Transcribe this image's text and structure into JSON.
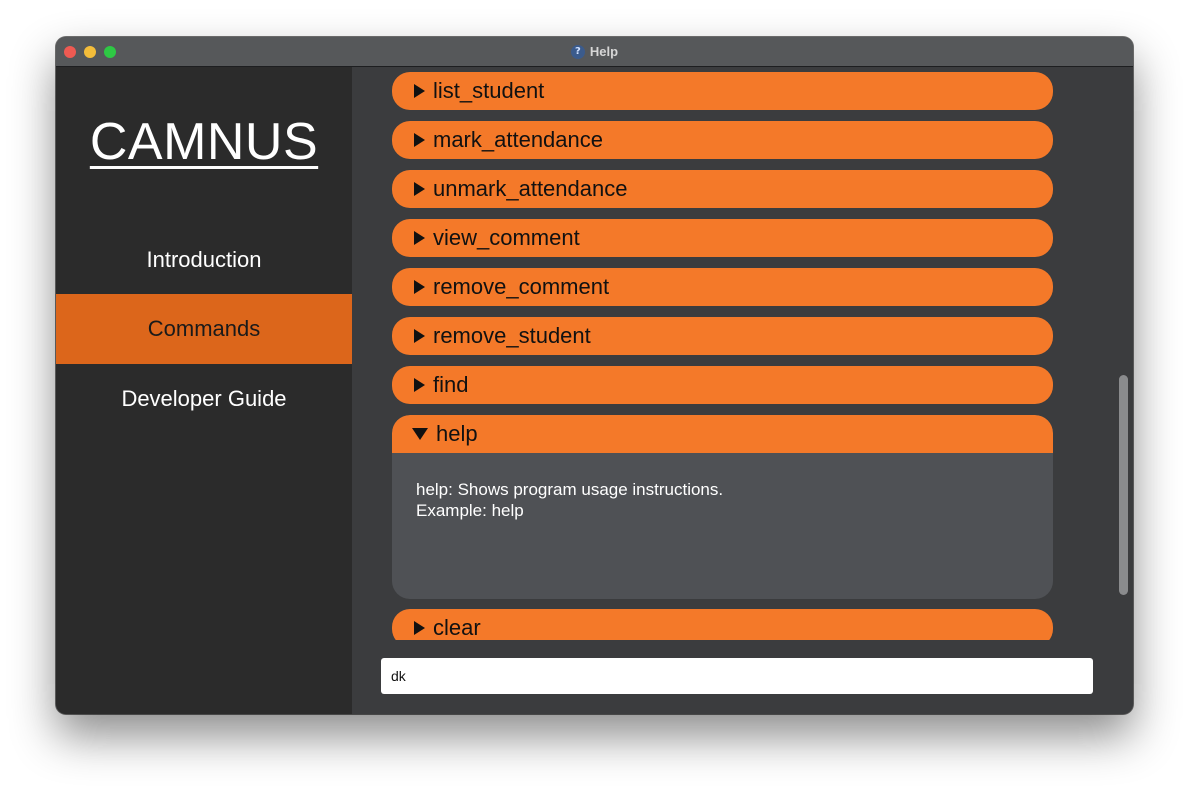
{
  "window": {
    "title": "Help",
    "title_icon": "question-mark-icon"
  },
  "sidebar": {
    "logo": "CAMNUS",
    "items": [
      {
        "label": "Introduction",
        "active": false
      },
      {
        "label": "Commands",
        "active": true
      },
      {
        "label": "Developer Guide",
        "active": false
      }
    ]
  },
  "commands": {
    "items": [
      {
        "label": "list_student",
        "expanded": false
      },
      {
        "label": "mark_attendance",
        "expanded": false
      },
      {
        "label": "unmark_attendance",
        "expanded": false
      },
      {
        "label": "view_comment",
        "expanded": false
      },
      {
        "label": "remove_comment",
        "expanded": false
      },
      {
        "label": "remove_student",
        "expanded": false
      },
      {
        "label": "find",
        "expanded": false
      },
      {
        "label": "help",
        "expanded": true,
        "description_line1": "help: Shows program usage instructions.",
        "description_line2": "Example: help"
      },
      {
        "label": "clear",
        "expanded": false
      }
    ]
  },
  "command_box": {
    "value": "dk"
  },
  "colors": {
    "accent_orange": "#f47929",
    "active_nav": "#dc661b",
    "sidebar_bg": "#2b2b2b",
    "content_bg": "#3b3c3e",
    "expanded_panel_bg": "#4f5155"
  }
}
